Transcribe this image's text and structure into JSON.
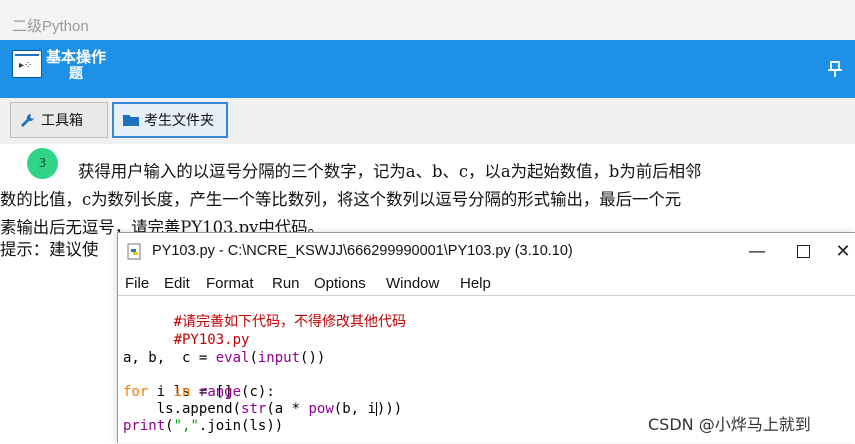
{
  "app": {
    "title": "二级Python"
  },
  "banner": {
    "title_line1": "基本操作",
    "title_line2": "题"
  },
  "toolbar": {
    "toolbox_label": "工具箱",
    "folder_label": "考生文件夹"
  },
  "question": {
    "number": "3",
    "line1": "获得用户输入的以逗号分隔的三个数字，记为a、b、c，以a为起始数值，b为前后相邻",
    "line2": "数的比值，c为数列长度，产生一个等比数列，将这个数列以逗号分隔的形式输出，最后一个元",
    "line3": "素输出后无逗号，请完善PY103.py中代码。",
    "hint": "提示：建议使"
  },
  "idle": {
    "title": "PY103.py - C:\\NCRE_KSWJJ\\666299990001\\PY103.py (3.10.10)",
    "menu": [
      "File",
      "Edit",
      "Format",
      "Run",
      "Options",
      "Window",
      "Help"
    ],
    "code": {
      "l1": "#请完善如下代码，不得修改其他代码",
      "l2": "#PY103.py",
      "l3_a": "a, b,  c = ",
      "l3_eval": "eval",
      "l3_b": "(",
      "l3_input": "input",
      "l3_c": "())",
      "l4": "ls = []",
      "l5_for": "for",
      "l5_a": " i ",
      "l5_in": "in",
      "l5_sp": " ",
      "l5_range": "range",
      "l5_b": "(c):",
      "l6_a": "    ls.append(",
      "l6_str": "str",
      "l6_b": "(a * ",
      "l6_pow": "pow",
      "l6_c": "(b, i",
      "l6_d": ")))",
      "l7_print": "print",
      "l7_a": "(",
      "l7_str": "\",\"",
      "l7_b": ".join(ls))"
    }
  },
  "watermark": "CSDN @小烨马上就到",
  "colors": {
    "banner": "#1e90e6",
    "badge": "#2fd487",
    "comment": "#c00000",
    "keyword": "#ff7700",
    "builtin": "#900090",
    "string": "#00a000"
  }
}
